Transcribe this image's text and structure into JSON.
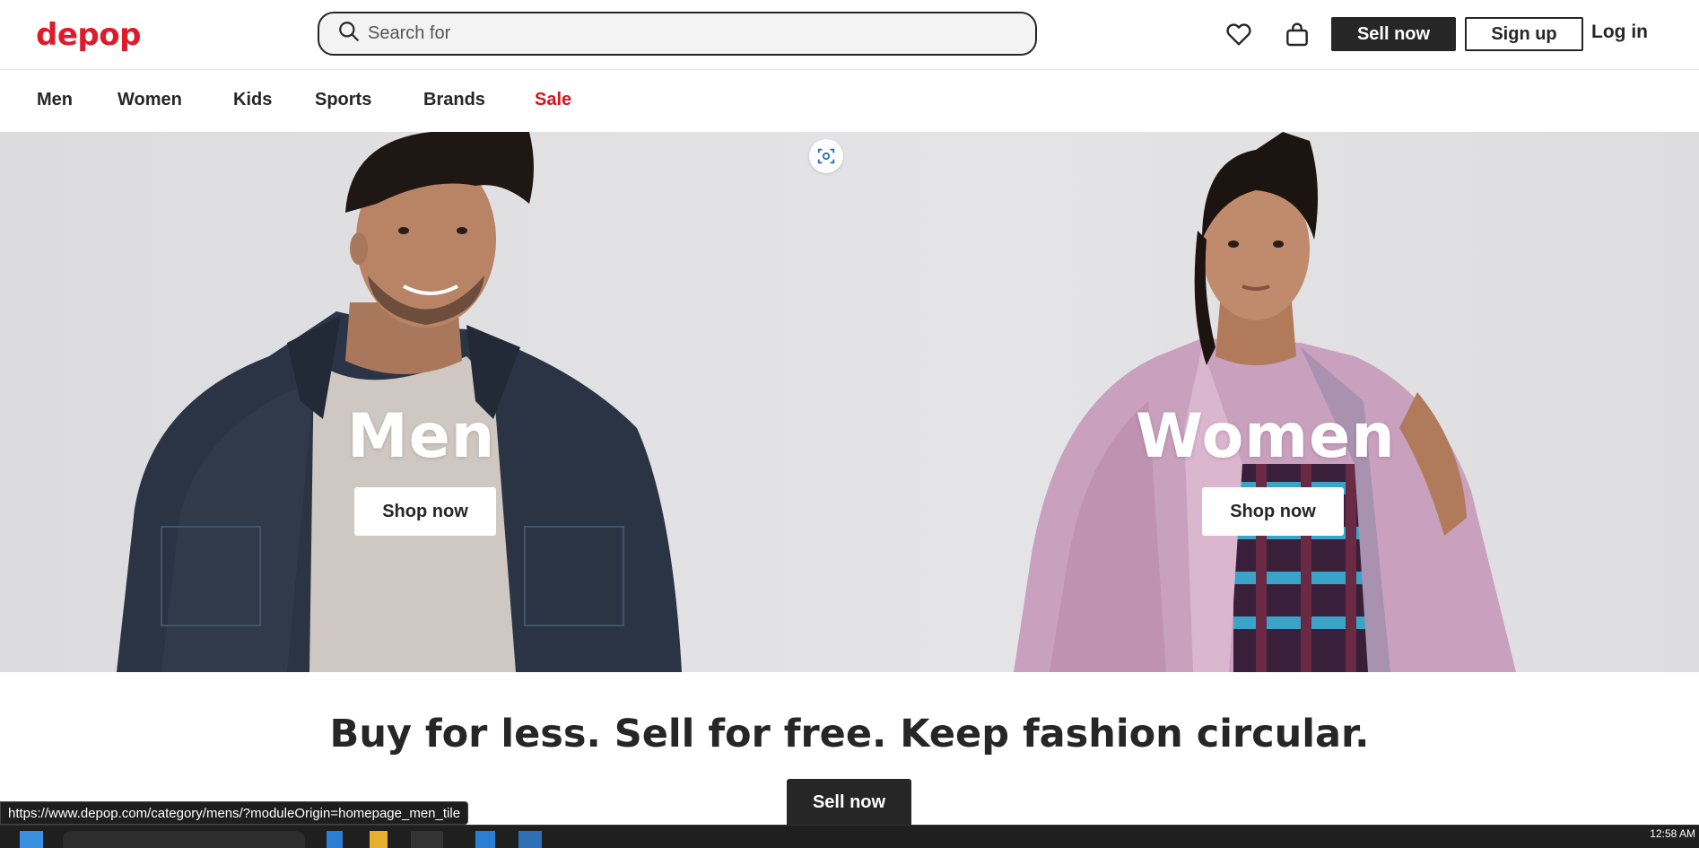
{
  "header": {
    "logo": "depop",
    "search_placeholder": "Search for",
    "sell_label": "Sell now",
    "signup_label": "Sign up",
    "login_label": "Log in",
    "icons": [
      "search-icon",
      "heart-icon",
      "bag-icon"
    ]
  },
  "nav": {
    "items": [
      {
        "label": "Men"
      },
      {
        "label": "Women"
      },
      {
        "label": "Kids"
      },
      {
        "label": "Sports"
      },
      {
        "label": "Brands"
      },
      {
        "label": "Sale"
      }
    ],
    "sale_color": "#d4141f"
  },
  "hero": {
    "tiles": [
      {
        "title": "Men",
        "button": "Shop now"
      },
      {
        "title": "Women",
        "button": "Shop now"
      }
    ]
  },
  "tagline": "Buy for less. Sell for free. Keep fashion circular.",
  "cta_sell_label": "Sell now",
  "status_url": "https://www.depop.com/category/mens/?moduleOrigin=homepage_men_tile",
  "taskbar": {
    "clock": "12:58 AM"
  },
  "colors": {
    "brand": "#e01a2b",
    "dark": "#262626"
  }
}
